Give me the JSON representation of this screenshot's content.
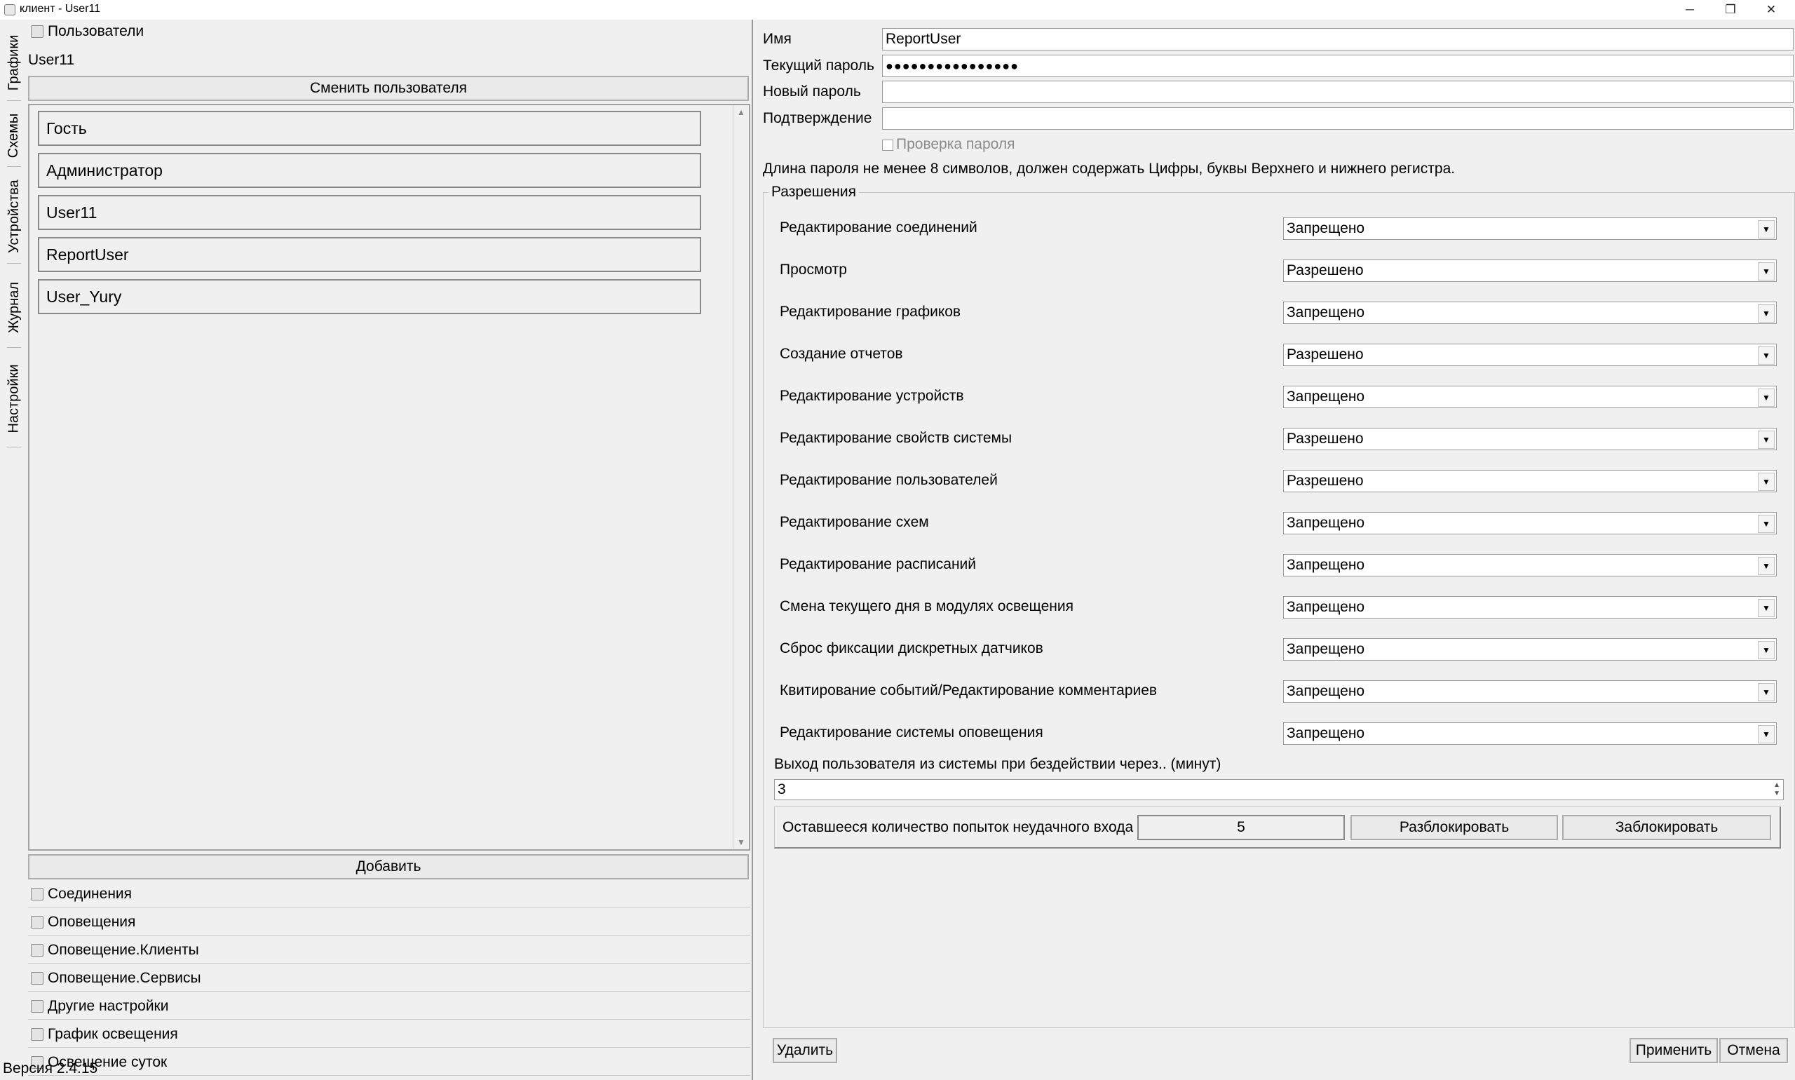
{
  "window": {
    "title": "клиент - User11",
    "minimize": "─",
    "maximize": "❐",
    "close": "✕"
  },
  "vtabs": [
    "Графики",
    "Схемы",
    "Устройства",
    "Журнал",
    "Настройки"
  ],
  "left": {
    "section_title": "Пользователи",
    "current_user": "User11",
    "change_user_btn": "Сменить пользователя",
    "users": [
      "Гость",
      "Администратор",
      "User11",
      "ReportUser",
      "User_Yury"
    ],
    "add_btn": "Добавить",
    "sections": [
      "Соединения",
      "Оповещения",
      "Оповещение.Клиенты",
      "Оповещение.Сервисы",
      "Другие настройки",
      "График освещения",
      "Освещение суток"
    ],
    "version": "Версия 2.4.15"
  },
  "right": {
    "name_label": "Имя",
    "name_value": "ReportUser",
    "current_password_label": "Текущий пароль",
    "current_password_value": "●●●●●●●●●●●●●●●●",
    "new_password_label": "Новый пароль",
    "new_password_value": "",
    "confirm_label": "Подтверждение",
    "confirm_value": "",
    "check_password_label": "Проверка пароля",
    "password_hint": "Длина пароля не менее 8 символов, должен содержать Цифры, буквы Верхнего и нижнего регистра.",
    "permissions_title": "Разрешения",
    "permissions": [
      {
        "label": "Редактирование соединений",
        "value": "Запрещено"
      },
      {
        "label": "Просмотр",
        "value": "Разрешено"
      },
      {
        "label": "Редактирование графиков",
        "value": "Запрещено"
      },
      {
        "label": "Создание отчетов",
        "value": "Разрешено"
      },
      {
        "label": "Редактирование устройств",
        "value": "Запрещено"
      },
      {
        "label": "Редактирование свойств системы",
        "value": "Разрешено"
      },
      {
        "label": "Редактирование пользователей",
        "value": "Разрешено"
      },
      {
        "label": "Редактирование схем",
        "value": "Запрещено"
      },
      {
        "label": "Редактирование расписаний",
        "value": "Запрещено"
      },
      {
        "label": "Смена текущего дня в модулях освещения",
        "value": "Запрещено"
      },
      {
        "label": "Сброс фиксации дискретных датчиков",
        "value": "Запрещено"
      },
      {
        "label": "Квитирование событий/Редактирование комментариев",
        "value": "Запрещено"
      },
      {
        "label": "Редактирование системы оповещения",
        "value": "Запрещено"
      }
    ],
    "logout_label": "Выход пользователя из системы при бездействии через.. (минут)",
    "logout_value": "3",
    "attempts_label": "Оставшееся количество попыток неудачного входа",
    "attempts_value": "5",
    "unlock_btn": "Разблокировать",
    "lock_btn": "Заблокировать",
    "delete_btn": "Удалить",
    "apply_btn": "Применить",
    "cancel_btn": "Отмена"
  }
}
